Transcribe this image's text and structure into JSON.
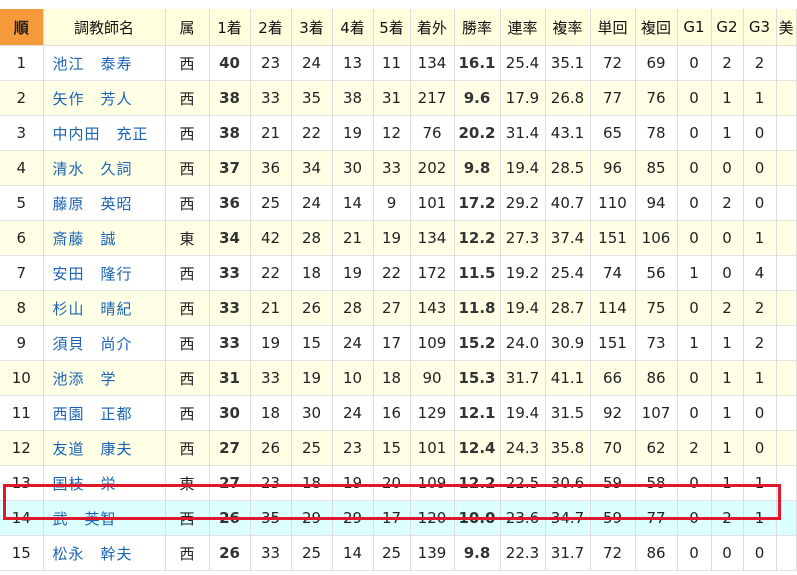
{
  "table": {
    "headers": [
      "順",
      "調教師名",
      "属",
      "1着",
      "2着",
      "3着",
      "4着",
      "5着",
      "着外",
      "勝率",
      "連率",
      "複率",
      "単回",
      "複回",
      "G1",
      "G2",
      "G3",
      "美"
    ],
    "rows": [
      [
        "1",
        "池江　泰寿",
        "西",
        "40",
        "23",
        "24",
        "13",
        "11",
        "134",
        "16.1",
        "25.4",
        "35.1",
        "72",
        "69",
        "0",
        "2",
        "2"
      ],
      [
        "2",
        "矢作　芳人",
        "西",
        "38",
        "33",
        "35",
        "38",
        "31",
        "217",
        "9.6",
        "17.9",
        "26.8",
        "77",
        "76",
        "0",
        "1",
        "1"
      ],
      [
        "3",
        "中内田　充正",
        "西",
        "38",
        "21",
        "22",
        "19",
        "12",
        "76",
        "20.2",
        "31.4",
        "43.1",
        "65",
        "78",
        "0",
        "1",
        "0"
      ],
      [
        "4",
        "清水　久詞",
        "西",
        "37",
        "36",
        "34",
        "30",
        "33",
        "202",
        "9.8",
        "19.4",
        "28.5",
        "96",
        "85",
        "0",
        "0",
        "0"
      ],
      [
        "5",
        "藤原　英昭",
        "西",
        "36",
        "25",
        "24",
        "14",
        "9",
        "101",
        "17.2",
        "29.2",
        "40.7",
        "110",
        "94",
        "0",
        "2",
        "0"
      ],
      [
        "6",
        "斎藤　誠",
        "東",
        "34",
        "42",
        "28",
        "21",
        "19",
        "134",
        "12.2",
        "27.3",
        "37.4",
        "151",
        "106",
        "0",
        "0",
        "1"
      ],
      [
        "7",
        "安田　隆行",
        "西",
        "33",
        "22",
        "18",
        "19",
        "22",
        "172",
        "11.5",
        "19.2",
        "25.4",
        "74",
        "56",
        "1",
        "0",
        "4"
      ],
      [
        "8",
        "杉山　晴紀",
        "西",
        "33",
        "21",
        "26",
        "28",
        "27",
        "143",
        "11.8",
        "19.4",
        "28.7",
        "114",
        "75",
        "0",
        "2",
        "2"
      ],
      [
        "9",
        "須貝　尚介",
        "西",
        "33",
        "19",
        "15",
        "24",
        "17",
        "109",
        "15.2",
        "24.0",
        "30.9",
        "151",
        "73",
        "1",
        "1",
        "2"
      ],
      [
        "10",
        "池添　学",
        "西",
        "31",
        "33",
        "19",
        "10",
        "18",
        "90",
        "15.3",
        "31.7",
        "41.1",
        "66",
        "86",
        "0",
        "1",
        "1"
      ],
      [
        "11",
        "西園　正都",
        "西",
        "30",
        "18",
        "30",
        "24",
        "16",
        "129",
        "12.1",
        "19.4",
        "31.5",
        "92",
        "107",
        "0",
        "1",
        "0"
      ],
      [
        "12",
        "友道　康夫",
        "西",
        "27",
        "26",
        "25",
        "23",
        "15",
        "101",
        "12.4",
        "24.3",
        "35.8",
        "70",
        "62",
        "2",
        "1",
        "0"
      ],
      [
        "13",
        "国枝　栄",
        "東",
        "27",
        "23",
        "18",
        "19",
        "20",
        "109",
        "12.2",
        "22.5",
        "30.6",
        "59",
        "58",
        "0",
        "1",
        "1"
      ],
      [
        "14",
        "武　英智",
        "西",
        "26",
        "35",
        "29",
        "29",
        "17",
        "120",
        "10.0",
        "23.6",
        "34.7",
        "59",
        "77",
        "0",
        "2",
        "1"
      ],
      [
        "15",
        "松永　幹夫",
        "西",
        "26",
        "33",
        "25",
        "14",
        "25",
        "139",
        "9.8",
        "22.3",
        "31.7",
        "72",
        "86",
        "0",
        "0",
        "0"
      ]
    ],
    "highlighted_row": "14"
  },
  "colors": {
    "rank_header": "#f49a3a",
    "header_bg": "#ffffdd",
    "alt_row": "#ffffe6",
    "highlight_row": "#dcffff",
    "highlight_border": "#e0182d",
    "link": "#1a63b5"
  }
}
